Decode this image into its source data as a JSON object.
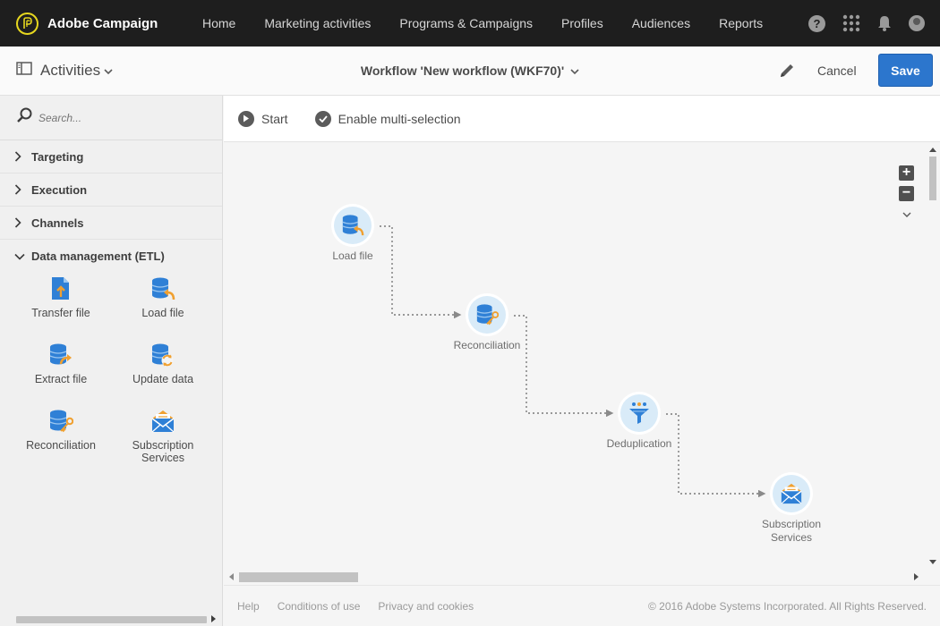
{
  "app": {
    "name": "Adobe Campaign"
  },
  "nav": [
    "Home",
    "Marketing activities",
    "Programs & Campaigns",
    "Profiles",
    "Audiences",
    "Reports"
  ],
  "header": {
    "activities_label": "Activities",
    "workflow_title": "Workflow 'New workflow (WKF70)'",
    "cancel_label": "Cancel",
    "save_label": "Save"
  },
  "sidebar": {
    "search_placeholder": "Search...",
    "categories": [
      "Targeting",
      "Execution",
      "Channels",
      "Data management (ETL)"
    ],
    "tiles": [
      "Transfer file",
      "Load file",
      "Extract file",
      "Update data",
      "Reconciliation",
      "Subscription Services"
    ]
  },
  "toolbar": {
    "start_label": "Start",
    "multi_label": "Enable multi-selection"
  },
  "workflow_nodes": [
    "Load file",
    "Reconciliation",
    "Deduplication",
    "Subscription Services"
  ],
  "footer": {
    "links": [
      "Help",
      "Conditions of use",
      "Privacy and cookies"
    ],
    "copyright": "© 2016 Adobe Systems Incorporated. All Rights Reserved."
  },
  "colors": {
    "accent": "#2c76cd",
    "topbar": "#1e1e1e",
    "icon_blue": "#2f80d6",
    "icon_orange": "#f0a030",
    "node_fill": "#d9ebf8",
    "logo_yellow": "#e6d71f"
  }
}
